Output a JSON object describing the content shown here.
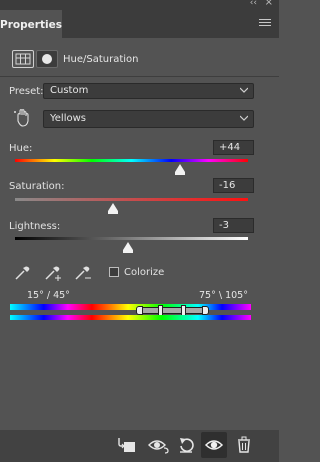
{
  "panel": {
    "tab_label": "Properties",
    "adjustment_title": "Hue/Saturation"
  },
  "preset": {
    "label": "Preset:",
    "value": "Custom"
  },
  "channel": {
    "value": "Yellows"
  },
  "hue": {
    "label": "Hue:",
    "value": "+44",
    "level_fraction": 0.71
  },
  "saturation": {
    "label": "Saturation:",
    "value": "-16",
    "level_fraction": 0.42
  },
  "lightness": {
    "label": "Lightness:",
    "value": "-3",
    "level_fraction": 0.485
  },
  "colorize": {
    "label": "Colorize",
    "checked": false
  },
  "range": {
    "left_label": "15° / 45°",
    "right_label": "75° \\ 105°"
  },
  "icons": {
    "eyedropper": "eyedropper-icon",
    "eyedropper_add": "eyedropper-plus-icon",
    "eyedropper_subtract": "eyedropper-minus-icon",
    "targeted_adjustment": "hand-icon",
    "clip_to_layer": "clip-to-layer-icon",
    "view_previous": "view-previous-icon",
    "reset": "reset-icon",
    "visibility": "eye-icon",
    "delete": "trash-icon"
  },
  "colors": {
    "panel_bg": "#535353",
    "dark_bar": "#3c3c3c",
    "field_bg": "#3c3c3c"
  }
}
